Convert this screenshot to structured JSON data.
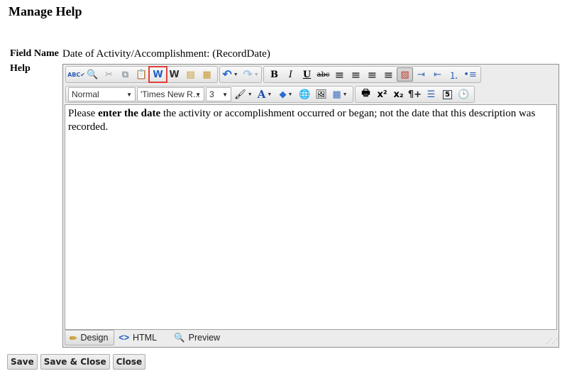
{
  "page": {
    "title": "Manage Help"
  },
  "field": {
    "label": "Field Name",
    "value": "Date of Activity/Accomplishment: (RecordDate)"
  },
  "help": {
    "label": "Help"
  },
  "editor": {
    "toolbar_row1": {
      "group1": [
        {
          "name": "spell-check",
          "glyph": "ABC✔",
          "color": "#2a5bb0"
        },
        {
          "name": "find",
          "glyph": "🔍",
          "color": "#1d4e9e"
        },
        {
          "name": "cut",
          "glyph": "✂",
          "color": "#9aa0a8"
        },
        {
          "name": "copy",
          "glyph": "⧉",
          "color": "#9aa0a8"
        },
        {
          "name": "paste",
          "glyph": "📋",
          "color": "#c8962c"
        },
        {
          "name": "paste-from-word",
          "glyph": "W",
          "color": "#1c5cc8",
          "highlighted": true
        },
        {
          "name": "paste-from-word-strip-font",
          "glyph": "W",
          "color": "#333"
        },
        {
          "name": "paste-plain-text",
          "glyph": "▤",
          "color": "#c8962c"
        },
        {
          "name": "paste-as-html",
          "glyph": "▦",
          "color": "#c8962c"
        }
      ],
      "undo": {
        "glyph": "↶",
        "color": "#2a6bd1"
      },
      "redo": {
        "glyph": "↷",
        "color": "#a8c4ea"
      },
      "group2": [
        {
          "name": "bold",
          "glyph": "B"
        },
        {
          "name": "italic",
          "glyph": "I"
        },
        {
          "name": "underline",
          "glyph": "U"
        },
        {
          "name": "strikethrough",
          "glyph": "abc"
        },
        {
          "name": "align-left",
          "glyph": "≡"
        },
        {
          "name": "align-center",
          "glyph": "≡"
        },
        {
          "name": "align-right",
          "glyph": "≡"
        },
        {
          "name": "justify",
          "glyph": "≡"
        },
        {
          "name": "remove-alignment",
          "glyph": "▨",
          "active": true
        },
        {
          "name": "indent",
          "glyph": "⇥"
        },
        {
          "name": "outdent",
          "glyph": "⇤"
        },
        {
          "name": "numbered-list",
          "glyph": "⒈"
        },
        {
          "name": "bulleted-list",
          "glyph": "•≡"
        }
      ]
    },
    "toolbar_row2": {
      "paragraph_style": "Normal",
      "font_name": "'Times New R...",
      "font_size": "3",
      "group1": [
        {
          "name": "format-stripper",
          "glyph": "🖌",
          "dropdown": true
        },
        {
          "name": "fore-color",
          "glyph": "A",
          "dropdown": true,
          "color": "#1c4fb0"
        },
        {
          "name": "back-color",
          "glyph": "◆",
          "dropdown": true,
          "color": "#2a6bd1"
        },
        {
          "name": "hyperlink",
          "glyph": "🌐"
        },
        {
          "name": "image",
          "glyph": "🖼"
        },
        {
          "name": "table",
          "glyph": "▦",
          "dropdown": true,
          "color": "#3a6ec0"
        }
      ],
      "group2": [
        {
          "name": "print",
          "glyph": "🖶"
        },
        {
          "name": "superscript",
          "glyph": "x²"
        },
        {
          "name": "subscript",
          "glyph": "x₂"
        },
        {
          "name": "paragraph",
          "glyph": "¶+"
        },
        {
          "name": "horizontal-rule",
          "glyph": "☰",
          "color": "#2a5bb0"
        },
        {
          "name": "insert-date",
          "glyph": "5"
        },
        {
          "name": "insert-time",
          "glyph": "🕒"
        }
      ]
    },
    "content": {
      "before": "Please ",
      "bold": "enter the date",
      "after": " the activity or accomplishment occurred or began; not the date that this description was recorded."
    },
    "modes": [
      {
        "label": "Design",
        "icon": "✏",
        "active": true
      },
      {
        "label": "HTML",
        "icon": "<>"
      },
      {
        "label": "Preview",
        "icon": "🔍"
      }
    ]
  },
  "buttons": {
    "save": "Save",
    "save_close": "Save & Close",
    "close": "Close"
  }
}
